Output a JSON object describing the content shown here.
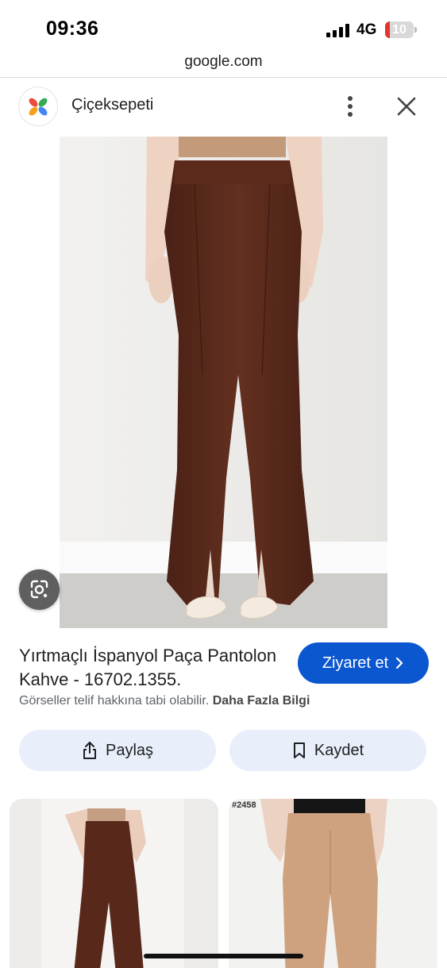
{
  "status_bar": {
    "time": "09:36",
    "network": "4G",
    "battery": "10",
    "battery_color": "#e3342f"
  },
  "browser": {
    "url": "google.com"
  },
  "source": {
    "name": "Çiçeksepeti",
    "logo_icon": "ciceksepeti-flower-logo",
    "more_icon": "more-vert-icon",
    "close_icon": "close-icon"
  },
  "product": {
    "title": "Yırtmaçlı İspanyol Paça Pantolon Kahve - 16702.1355.",
    "visit_label": "Ziyaret et",
    "copyright_text": "Görseller telif hakkına tabi olabilir.",
    "more_info_label": "Daha Fazla Bilgi"
  },
  "actions": {
    "share_label": "Paylaş",
    "save_label": "Kaydet"
  },
  "related": [
    {
      "code": ""
    },
    {
      "code": "#2458"
    }
  ],
  "colors": {
    "accent": "#0b57d0",
    "chip_bg": "#e8effa",
    "pants_brown": "#5a2a1c",
    "pants_beige": "#cfa27f"
  }
}
